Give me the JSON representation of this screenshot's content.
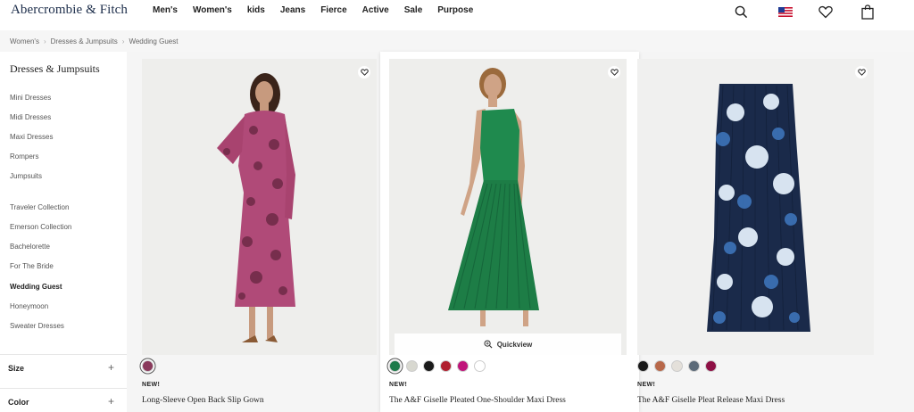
{
  "brand": {
    "logo": "Abercrombie & Fitch"
  },
  "nav": {
    "items": [
      "Men's",
      "Women's",
      "kids",
      "Jeans",
      "Fierce",
      "Active",
      "Sale",
      "Purpose"
    ]
  },
  "header_icons": [
    "search-icon",
    "us-flag-icon",
    "heart-icon",
    "shopping-bag-icon"
  ],
  "breadcrumb": [
    "Women's",
    "Dresses & Jumpsuits",
    "Wedding Guest"
  ],
  "sidebar": {
    "title": "Dresses & Jumpsuits",
    "group1": [
      "Mini Dresses",
      "Midi Dresses",
      "Maxi Dresses",
      "Rompers",
      "Jumpsuits"
    ],
    "group2": [
      "Traveler Collection",
      "Emerson Collection",
      "Bachelorette",
      "For The Bride",
      "Wedding Guest",
      "Honeymoon",
      "Sweater Dresses"
    ],
    "active": "Wedding Guest",
    "filters": [
      "Size",
      "Color"
    ]
  },
  "products": [
    {
      "badge": "NEW!",
      "name": "Long-Sleeve Open Back Slip Gown",
      "swatches": [
        "#8a3a5c"
      ]
    },
    {
      "badge": "NEW!",
      "name": "The A&F Giselle Pleated One-Shoulder Maxi Dress",
      "quickview": "Quickview",
      "swatches": [
        "#1e7a4a",
        "#d8d8d0",
        "#1a1a1a",
        "#b0202f",
        "#c0147a",
        "#ffffff"
      ]
    },
    {
      "badge": "NEW!",
      "name": "The A&F Giselle Pleat Release Maxi Dress",
      "swatches": [
        "#1a1a1a",
        "#b8684a",
        "#e4e0da",
        "#5c6a78",
        "#8e1045"
      ]
    }
  ],
  "colors": {
    "logo": "#1c2d4a",
    "band": "#f6f6f6"
  }
}
